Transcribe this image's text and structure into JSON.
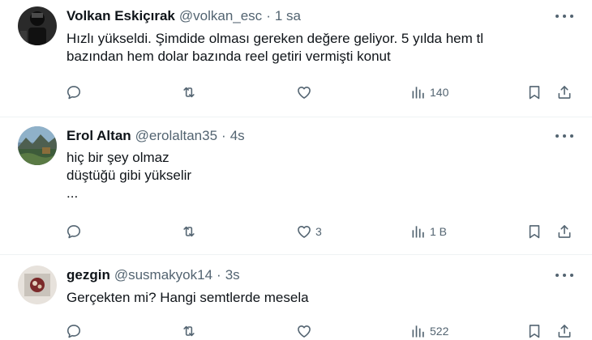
{
  "tweets": [
    {
      "name": "Volkan Eskiçırak",
      "handle": "@volkan_esc",
      "separator": "·",
      "time": "1 sa",
      "lines": [
        "Hızlı yükseldi. Şimdide olması gereken değere geliyor. 5 yılda hem tl",
        "bazından hem dolar bazında reel getiri vermişti konut"
      ],
      "likes": "",
      "views": "140"
    },
    {
      "name": "Erol Altan",
      "handle": "@erolaltan35",
      "separator": "·",
      "time": "4s",
      "lines": [
        "hiç bir şey olmaz",
        "düştüğü gibi yükselir",
        "..."
      ],
      "likes": "3",
      "views": "1 B"
    },
    {
      "name": "gezgin",
      "handle": "@susmakyok14",
      "separator": "·",
      "time": "3s",
      "lines": [
        "Gerçekten mi? Hangi semtlerde mesela"
      ],
      "likes": "",
      "views": "522"
    }
  ],
  "icons": {
    "reply": "reply-icon",
    "retweet": "retweet-icon",
    "like": "like-icon",
    "views": "views-icon",
    "bookmark": "bookmark-icon",
    "share": "share-icon",
    "more": "more-icon"
  },
  "colors": {
    "text": "#0f1419",
    "secondary": "#536471",
    "divider": "#eff3f4"
  }
}
